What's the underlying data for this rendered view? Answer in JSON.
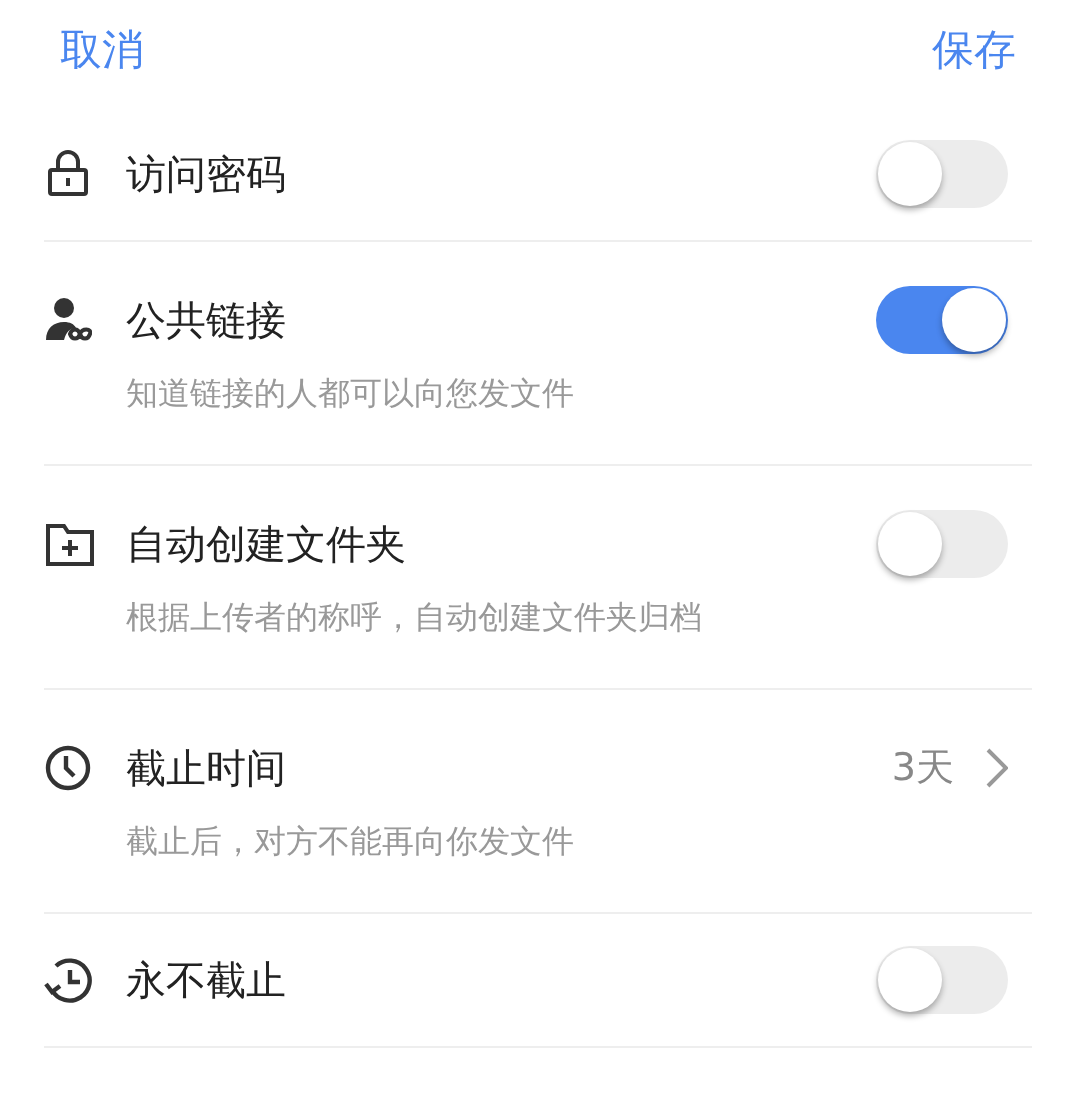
{
  "header": {
    "cancel": "取消",
    "save": "保存"
  },
  "settings": [
    {
      "kind": "switch",
      "title": "访问密码",
      "on": false
    },
    {
      "kind": "switch",
      "title": "公共链接",
      "description": "知道链接的人都可以向您发文件",
      "on": true
    },
    {
      "kind": "switch",
      "title": "自动创建文件夹",
      "description": "根据上传者的称呼，自动创建文件夹归档",
      "on": false
    },
    {
      "kind": "value",
      "title": "截止时间",
      "description": "截止后，对方不能再向你发文件",
      "value": "3天"
    },
    {
      "kind": "switch",
      "title": "永不截止",
      "on": false
    }
  ]
}
